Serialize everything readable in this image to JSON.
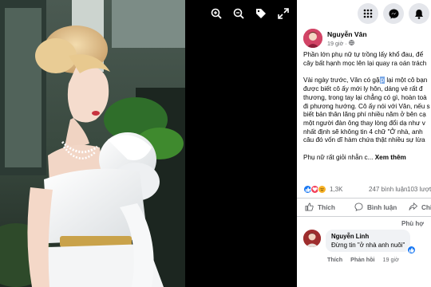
{
  "viewer": {
    "tools": [
      "zoom-in-icon",
      "zoom-out-icon",
      "tag-icon",
      "fullscreen-icon"
    ]
  },
  "topbar": {
    "buttons": [
      "menu-grid-icon",
      "messenger-icon",
      "notifications-icon"
    ]
  },
  "post": {
    "author": "Nguyễn Vân",
    "time": "19 giờ · ",
    "lines": [
      "Phần lớn phụ nữ tự trồng lấy khổ đau, để",
      "cây bất hạnh mọc lên lại quay ra oán trách"
    ],
    "para2_pre": "Vài ngày trước, Vân có gặ",
    "para2_cursor": "p",
    "para2_post": " lại một cô bạn",
    "para2_lines": [
      "được biết cô ấy mới ly hôn, dáng vẻ rất đ",
      "thương, trong tay lại chẳng có gì, hoàn toà",
      "đi phương hướng. Cô ấy nói với Vân, nếu s",
      "biết bản thân lãng phí nhiều năm ở bên cạ",
      "một người đàn ông thay lòng đổi dạ như v",
      "nhất định sẽ không tin 4 chữ \"Ở nhà, anh",
      "câu đó vốn dĩ hàm chứa thật nhiều sự lừa"
    ],
    "para3": "Phụ nữ rất giỏi nhẫn c...",
    "see_more": "Xem thêm"
  },
  "stats": {
    "reaction_count": "1,3K",
    "comments": "247 bình luận",
    "shares": "103 lượt"
  },
  "actions": {
    "like": "Thích",
    "comment": "Bình luận",
    "share": "Chia sẻ"
  },
  "sort_label": "Phù hợ",
  "comment": {
    "author": "Nguyễn Linh",
    "text": "Đừng tin \"ở nhà anh nuôi\"",
    "like": "Thích",
    "reply": "Phản hồi",
    "time": "19 giờ"
  },
  "colors": {
    "like_blue": "#1877f2",
    "love_red": "#f33e58",
    "care_yellow": "#f7b125",
    "panel_bg": "#ffffff",
    "viewer_bg": "#000000"
  }
}
